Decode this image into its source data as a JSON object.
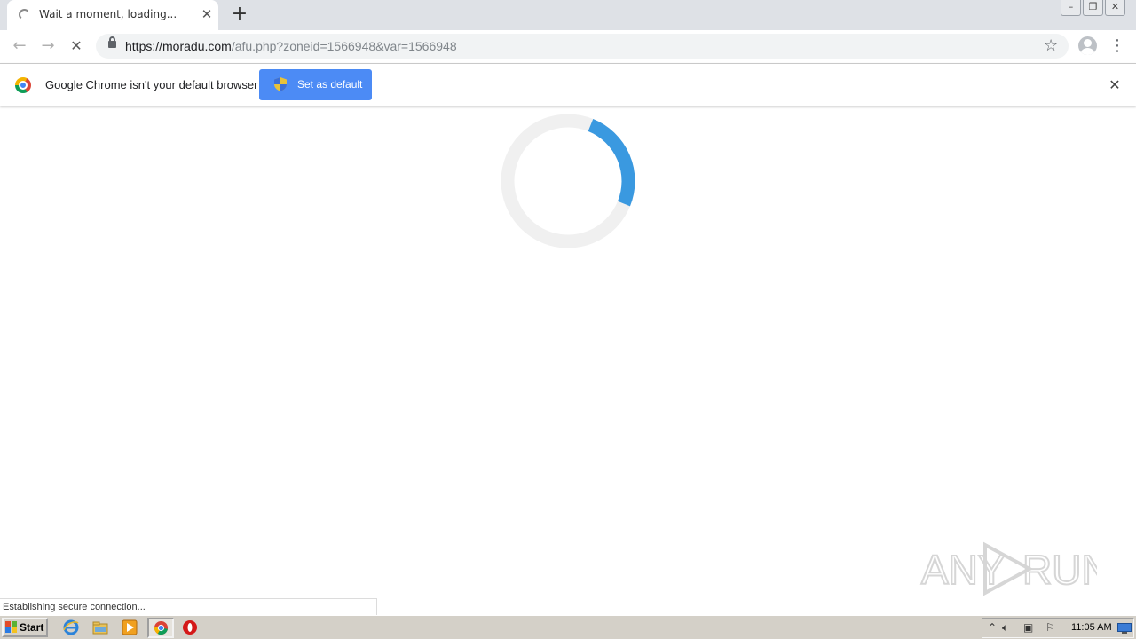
{
  "browser": {
    "tab": {
      "title": "Wait a moment, loading..."
    },
    "new_tab_label": "+",
    "url": {
      "host": "https://moradu.com",
      "path": "/afu.php?zoneid=1566948&var=1566948"
    },
    "icons": [
      "back-arrow-icon",
      "forward-arrow-icon",
      "stop-loading-icon",
      "lock-icon",
      "bookmark-star-icon",
      "profile-avatar-icon",
      "kebab-menu-icon"
    ]
  },
  "infobar": {
    "message": "Google Chrome isn't your default browser",
    "button_label": "Set as default"
  },
  "page": {
    "loading": true,
    "spinner_color": "#3a99e0",
    "spinner_track_color": "#f0f0f0",
    "spinner_progress_fraction": 0.25
  },
  "statusbar": {
    "text": "Establishing secure connection..."
  },
  "watermark": {
    "text": "ANY RUN"
  },
  "taskbar": {
    "start_label": "Start",
    "quicklaunch": [
      "internet-explorer-icon",
      "file-explorer-icon",
      "media-player-icon",
      "chrome-icon",
      "opera-icon"
    ],
    "tray_icons": [
      "show-hidden-icons",
      "volume-icon",
      "network-icon",
      "action-center-flag-icon",
      "show-desktop-icon"
    ],
    "clock": "11:05 AM"
  },
  "colors": {
    "accent_button": "#4c8bf5",
    "tab_strip": "#dee1e6",
    "taskbar": "#d4d0c8"
  }
}
